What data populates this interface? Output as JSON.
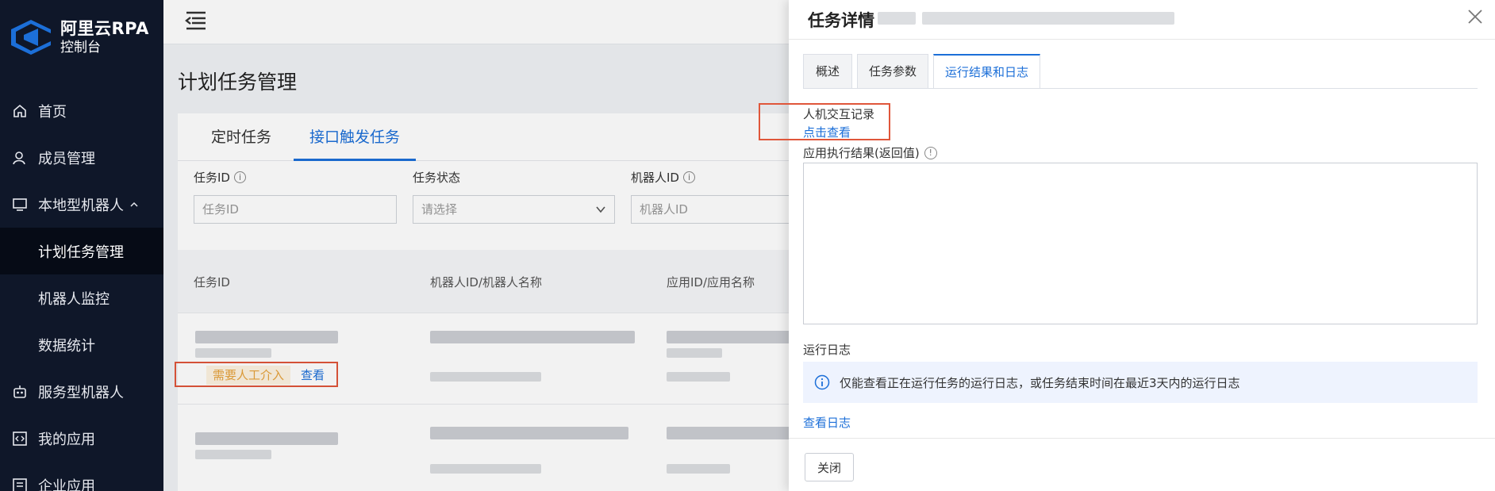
{
  "sidebar": {
    "logo_title": "阿里云RPA",
    "logo_sub": "控制台",
    "items": [
      {
        "label": "首页",
        "icon": "home-icon"
      },
      {
        "label": "成员管理",
        "icon": "user-icon"
      },
      {
        "label": "本地型机器人",
        "icon": "monitor-icon"
      },
      {
        "label": "计划任务管理"
      },
      {
        "label": "机器人监控"
      },
      {
        "label": "数据统计"
      },
      {
        "label": "服务型机器人",
        "icon": "robot-icon"
      },
      {
        "label": "我的应用",
        "icon": "code-icon"
      },
      {
        "label": "企业应用",
        "icon": "enterprise-icon"
      }
    ]
  },
  "main": {
    "page_title": "计划任务管理",
    "tabs": [
      {
        "label": "定时任务"
      },
      {
        "label": "接口触发任务"
      }
    ],
    "filters": [
      {
        "label": "任务ID",
        "placeholder": "任务ID"
      },
      {
        "label": "任务状态",
        "placeholder": "请选择"
      },
      {
        "label": "机器人ID",
        "placeholder": "机器人ID"
      }
    ],
    "columns": [
      "任务ID",
      "机器人ID/机器人名称",
      "应用ID/应用名称"
    ],
    "row_badge": "需要人工介入",
    "row_link": "查看"
  },
  "drawer": {
    "title": "任务详情",
    "tabs": [
      {
        "label": "概述"
      },
      {
        "label": "任务参数"
      },
      {
        "label": "运行结果和日志"
      }
    ],
    "interaction_label": "人机交互记录",
    "interaction_link": "点击查看",
    "result_label": "应用执行结果(返回值)",
    "log_label": "运行日志",
    "alert_text": "仅能查看正在运行任务的运行日志，或任务结束时间在最近3天内的运行日志",
    "view_log_link": "查看日志",
    "close_button": "关闭"
  },
  "colors": {
    "accent": "#1c6fd8",
    "sidebar_bg": "#0f1729",
    "warning": "#e6a23c",
    "highlight_box": "#e0563a"
  }
}
